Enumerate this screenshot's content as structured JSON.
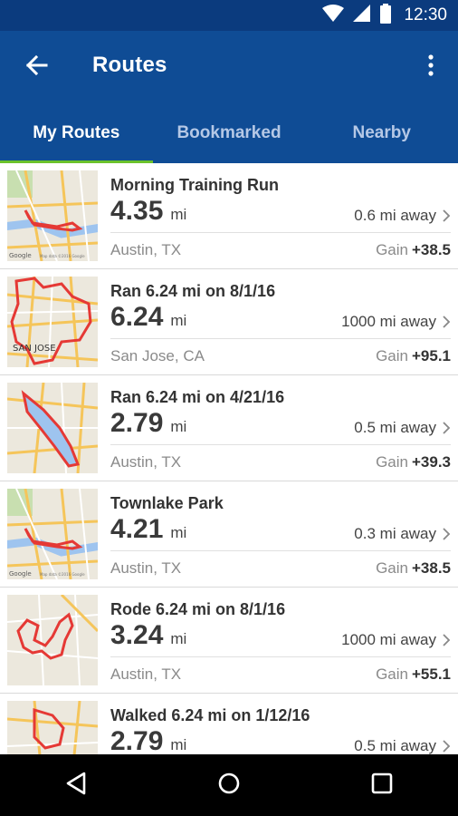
{
  "status_bar": {
    "time": "12:30",
    "icons": [
      "wifi-icon",
      "signal-icon",
      "battery-icon"
    ]
  },
  "app_bar": {
    "title": "Routes",
    "back_icon": "arrow-left-icon",
    "menu_icon": "more-vert-icon"
  },
  "tabs": [
    {
      "label": "My Routes",
      "active": true
    },
    {
      "label": "Bookmarked",
      "active": false
    },
    {
      "label": "Nearby",
      "active": false
    }
  ],
  "routes": [
    {
      "name": "Morning Training Run",
      "distance": "4.35",
      "unit": "mi",
      "away": "0.6 mi away",
      "city": "Austin, TX",
      "gain_label": "Gain",
      "gain_value": "+38.5"
    },
    {
      "name": "Ran 6.24 mi on 8/1/16",
      "distance": "6.24",
      "unit": "mi",
      "away": "1000 mi away",
      "city": "San Jose, CA",
      "gain_label": "Gain",
      "gain_value": "+95.1"
    },
    {
      "name": "Ran 6.24 mi on 4/21/16",
      "distance": "2.79",
      "unit": "mi",
      "away": "0.5 mi away",
      "city": "Austin, TX",
      "gain_label": "Gain",
      "gain_value": "+39.3"
    },
    {
      "name": "Townlake Park",
      "distance": "4.21",
      "unit": "mi",
      "away": "0.3 mi away",
      "city": "Austin, TX",
      "gain_label": "Gain",
      "gain_value": "+38.5"
    },
    {
      "name": "Rode 6.24 mi on 8/1/16",
      "distance": "3.24",
      "unit": "mi",
      "away": "1000 mi away",
      "city": "Austin, TX",
      "gain_label": "Gain",
      "gain_value": "+55.1"
    },
    {
      "name": "Walked 6.24 mi on 1/12/16",
      "distance": "2.79",
      "unit": "mi",
      "away": "0.5 mi away",
      "city": "",
      "gain_label": "",
      "gain_value": ""
    }
  ],
  "map_labels": {
    "google": "Google",
    "map_data": "Map data ©2016 Google",
    "san_jose": "SAN JOSE"
  },
  "nav_bar": {
    "back_icon": "nav-back-icon",
    "home_icon": "nav-home-icon",
    "recents_icon": "nav-recents-icon"
  },
  "colors": {
    "status_bar": "#0b3b7e",
    "app_bar": "#0f4c95",
    "tab_indicator": "#6bc22b",
    "route_line": "#e53935"
  }
}
